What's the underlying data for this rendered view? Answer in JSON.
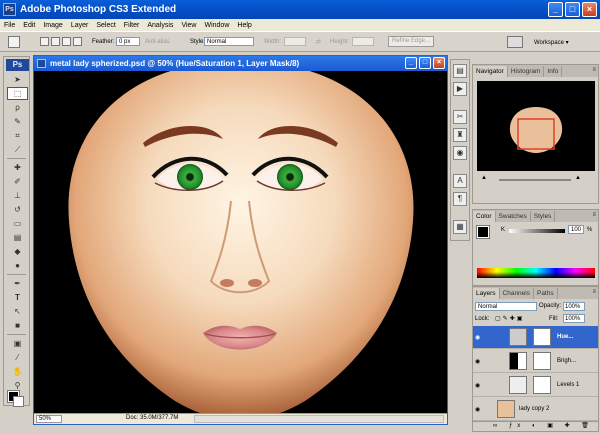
{
  "app": {
    "title": "Adobe Photoshop CS3 Extended",
    "badge": "Ps"
  },
  "menu": [
    "File",
    "Edit",
    "Image",
    "Layer",
    "Select",
    "Filter",
    "Analysis",
    "View",
    "Window",
    "Help"
  ],
  "options": {
    "feather_label": "Feather:",
    "feather_value": "0 px",
    "antialias_label": "Anti-alias",
    "style_label": "Style:",
    "style_value": "Normal",
    "width_label": "Width:",
    "height_label": "Height:",
    "refine_edge": "Refine Edge...",
    "workspace": "Workspace ▾"
  },
  "tools": {
    "logo": "Ps",
    "items": [
      "move-tool",
      "marquee-tool",
      "lasso-tool",
      "quick-select-tool",
      "crop-tool",
      "slice-tool",
      "healing-tool",
      "brush-tool",
      "clone-stamp-tool",
      "history-brush-tool",
      "eraser-tool",
      "gradient-tool",
      "blur-tool",
      "dodge-tool",
      "pen-tool",
      "type-tool",
      "path-select-tool",
      "shape-tool",
      "notes-tool",
      "eyedropper-tool",
      "hand-tool",
      "zoom-tool"
    ]
  },
  "document": {
    "title": "metal lady spherized.psd @ 50% (Hue/Saturation 1, Layer Mask/8)",
    "zoom": "50%",
    "doc_info": "Doc: 35.0M/377.7M"
  },
  "navigator": {
    "tabs": [
      "Navigator",
      "Histogram",
      "Info"
    ]
  },
  "color": {
    "tabs": [
      "Color",
      "Swatches",
      "Styles"
    ],
    "channel_label": "K",
    "channel_value": "100",
    "pct": "%"
  },
  "layers": {
    "tabs": [
      "Layers",
      "Channels",
      "Paths"
    ],
    "blend_mode": "Normal",
    "opacity_label": "Opacity:",
    "opacity_value": "100%",
    "lock_label": "Lock:",
    "fill_label": "Fill:",
    "fill_value": "100%",
    "rows": [
      {
        "name": "Hue..."
      },
      {
        "name": "Brigh..."
      },
      {
        "name": "Levels 1"
      },
      {
        "name": "lady copy 2"
      }
    ]
  },
  "colors": {
    "title_bar": "#0550c8",
    "selected_layer": "#3366cc"
  }
}
